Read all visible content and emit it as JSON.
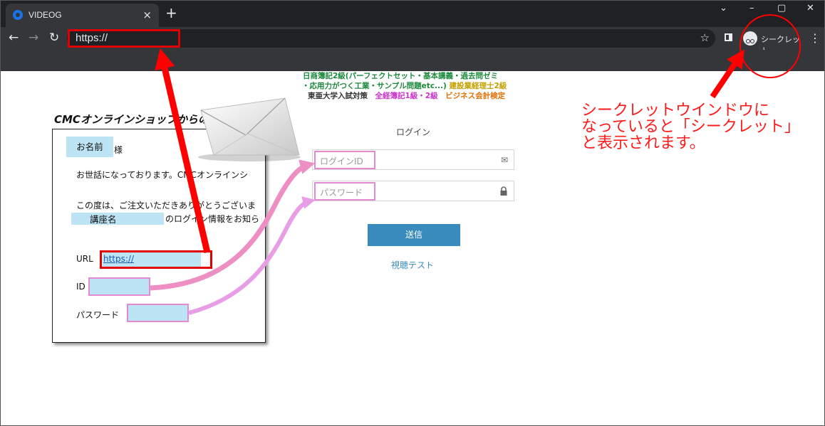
{
  "browser": {
    "tab_title": "VIDEOG",
    "tab_close": "×",
    "new_tab": "+",
    "url": "https://",
    "incognito_label": "シークレット",
    "window_controls": [
      "⌄",
      "–",
      "▢",
      "✕"
    ]
  },
  "promo": {
    "line1": "日商簿記2級(パーフェクトセット・基本講義・過去問ゼミ",
    "line2_main": "・応用力がつく工業・サンプル問題etc...)",
    "line2_accent": "建設業経理士2級",
    "line3_a": "東亜大学入試対策",
    "line3_b": "全経簿記1級・2級",
    "line3_c": "ビジネス会計検定"
  },
  "login": {
    "title": "ログイン",
    "id_placeholder": "ログインID",
    "password_placeholder": "パスワード",
    "submit_label": "送信",
    "test_link": "視聴テスト"
  },
  "email": {
    "heading": "CMCオンラインショップからのメール",
    "name_chip": "お名前",
    "honorific": "様",
    "greeting": "お世話になっております。CMCオンラインシ",
    "thanks": "この度は、ご注文いただきありがとうございま",
    "course_chip": "講座名",
    "notice": "のログイン情報をお知ら",
    "url_label": "URL",
    "url_value": "https://",
    "id_label": "ID",
    "password_label": "パスワード"
  },
  "annotation": {
    "line1": "シークレットウインドウに",
    "line2": "なっていると「シークレット」",
    "line3": "と表示されます。"
  },
  "colors": {
    "highlight_red": "#e00000",
    "highlight_pink": "#e38ad0",
    "chip_blue": "#bde4f4",
    "button_blue": "#3a8bbd"
  },
  "icons": [
    "videog-favicon",
    "back-arrow-icon",
    "forward-arrow-icon",
    "reload-icon",
    "star-icon",
    "side-panel-icon",
    "incognito-icon",
    "menu-dots-icon",
    "mail-icon",
    "lock-icon",
    "envelope-illustration"
  ]
}
